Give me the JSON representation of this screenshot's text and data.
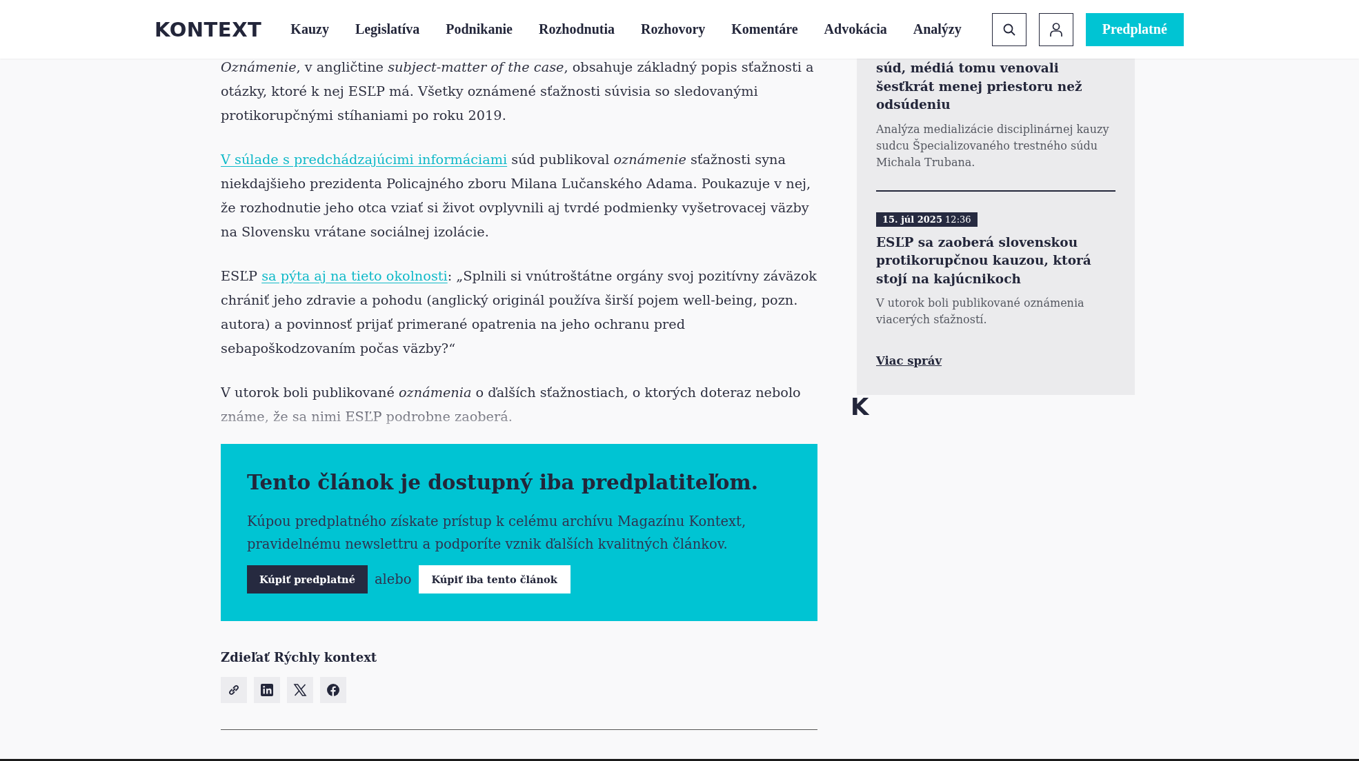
{
  "header": {
    "logo": "KONTEXT",
    "nav": [
      {
        "label": "Kauzy"
      },
      {
        "label": "Legislatíva"
      },
      {
        "label": "Podnikanie"
      },
      {
        "label": "Rozhodnutia"
      },
      {
        "label": "Rozhovory"
      },
      {
        "label": "Komentáre"
      },
      {
        "label": "Advokácia"
      },
      {
        "label": "Analýzy"
      }
    ],
    "subscribe": "Predplatné"
  },
  "article": {
    "paragraphs": [
      [
        {
          "kind": "em",
          "text": "Oznámenie"
        },
        {
          "kind": "text",
          "text": ", v angličtine "
        },
        {
          "kind": "em",
          "text": "subject-matter of the case"
        },
        {
          "kind": "text",
          "text": ", obsahuje základný popis sťažnosti a otázky, ktoré k nej ESĽP má. Všetky oznámené sťažnosti súvisia so sledovanými protikorupčnými stíhaniami po roku 2019."
        }
      ],
      [
        {
          "kind": "link",
          "text": "V súlade s predchádzajúcimi informáciami"
        },
        {
          "kind": "text",
          "text": " súd publikoval "
        },
        {
          "kind": "em",
          "text": "oznámenie"
        },
        {
          "kind": "text",
          "text": " sťažnosti syna niekdajšieho prezidenta Policajného zboru Milana Lučanského Adama. Poukazuje v nej, že rozhodnutie jeho otca vziať si život ovplyvnili aj tvrdé podmienky vyšetrovacej väzby na Slovensku vrátane sociálnej izolácie."
        }
      ],
      [
        {
          "kind": "text",
          "text": "ESĽP "
        },
        {
          "kind": "link",
          "text": "sa pýta aj na tieto okolnosti"
        },
        {
          "kind": "text",
          "text": ": „Splnili si vnútroštátne orgány svoj pozitívny záväzok chrániť jeho zdravie a pohodu (anglický originál používa širší pojem well-being, pozn. autora) a povinnosť prijať primerané opatrenia na jeho ochranu pred sebapoškodzovaním počas väzby?“"
        }
      ],
      [
        {
          "kind": "text",
          "text": "V utorok boli publikované "
        },
        {
          "kind": "em",
          "text": "oznámenia"
        },
        {
          "kind": "text",
          "text": " o ďalších sťažnostiach, o ktorých doteraz nebolo známe, že sa nimi ESĽP podrobne zaoberá."
        }
      ]
    ]
  },
  "paywall": {
    "title": "Tento článok je dostupný iba predplatiteľom.",
    "text": "Kúpou predplatného získate prístup k celému archívu Magazínu Kontext, pravidelnému newslettru a podporíte vznik ďalších kvalitných článkov.",
    "primary_button": "Kúpiť predplatné",
    "or_text": "alebo",
    "secondary_button": "Kúpiť iba tento článok"
  },
  "share": {
    "title": "Zdieľať Rýchly kontext",
    "buttons": [
      {
        "kind": "link"
      },
      {
        "kind": "linkedin"
      },
      {
        "kind": "x"
      },
      {
        "kind": "facebook"
      }
    ]
  },
  "sidebar": {
    "items": [
      {
        "title": "súd, médiá tomu venovali šesťkrát menej priestoru než odsúdeniu",
        "summary": "Analýza medializácie disciplinárnej kauzy sudcu Špecializovaného trestného súdu Michala Trubana."
      },
      {
        "date": "**15. júl 2025** 12:36",
        "title": "ESĽP sa zaoberá slovenskou protikorupčnou kauzou, ktorá stojí na kajúcnikoch",
        "summary": "V utorok boli publikované oznámenia viacerých sťažností."
      }
    ],
    "more_link": "Viac správ",
    "logo_mark": "K"
  }
}
